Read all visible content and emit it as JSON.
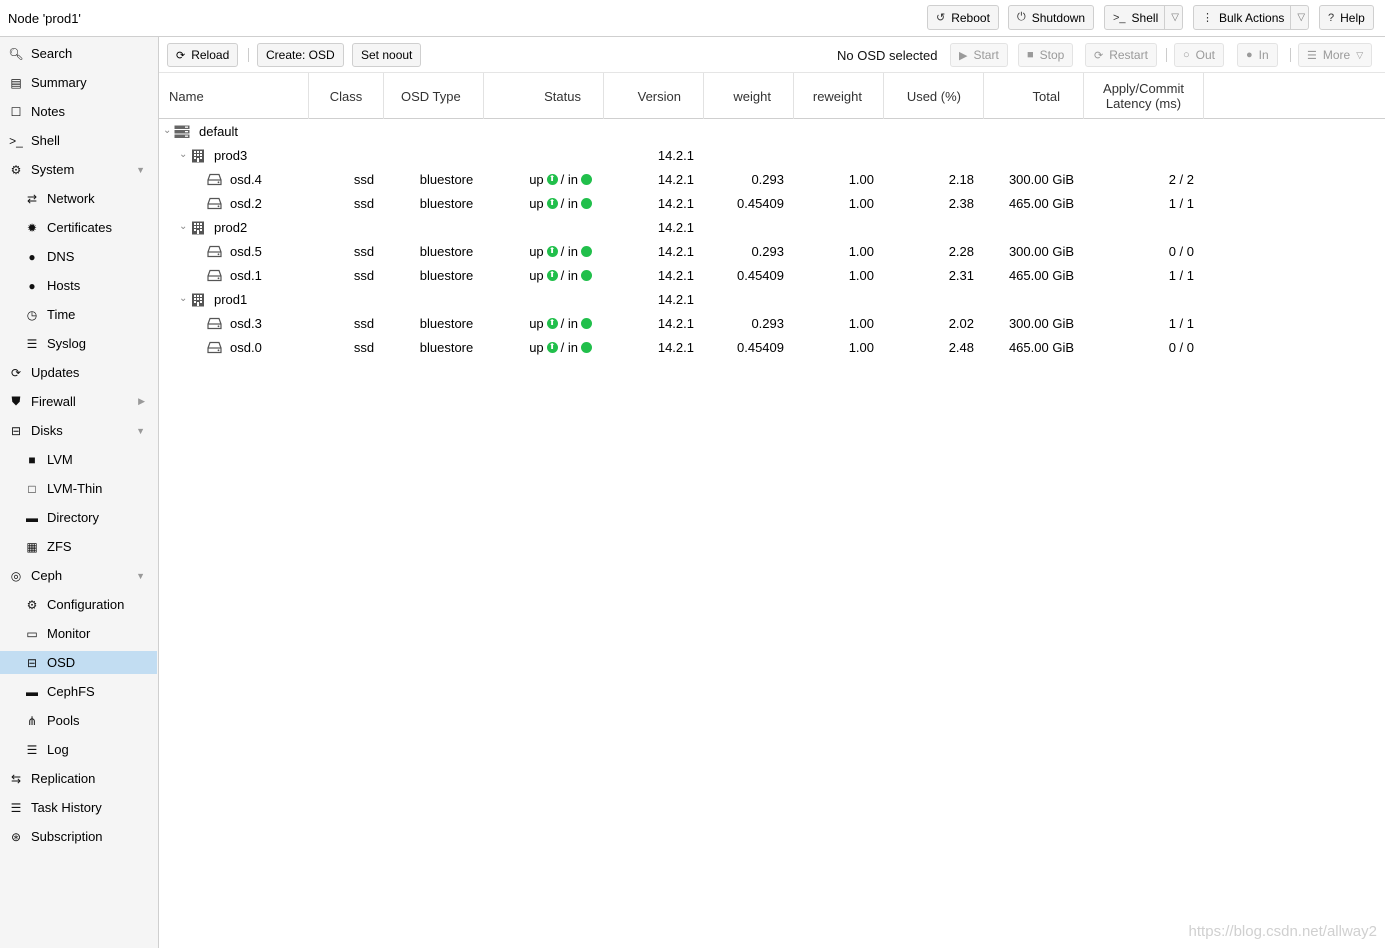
{
  "header": {
    "title": "Node 'prod1'",
    "reboot": "Reboot",
    "shutdown": "Shutdown",
    "shell": "Shell",
    "bulk": "Bulk Actions",
    "help": "Help"
  },
  "sidebar": {
    "items": [
      {
        "label": "Search",
        "icon": "search-icon"
      },
      {
        "label": "Summary",
        "icon": "book-icon"
      },
      {
        "label": "Notes",
        "icon": "note-icon"
      },
      {
        "label": "Shell",
        "icon": "terminal-icon"
      },
      {
        "label": "System",
        "icon": "cogs-icon"
      },
      {
        "label": "Network",
        "icon": "exchange-icon"
      },
      {
        "label": "Certificates",
        "icon": "certificate-icon"
      },
      {
        "label": "DNS",
        "icon": "globe-icon"
      },
      {
        "label": "Hosts",
        "icon": "globe-icon"
      },
      {
        "label": "Time",
        "icon": "clock-icon"
      },
      {
        "label": "Syslog",
        "icon": "list-icon"
      },
      {
        "label": "Updates",
        "icon": "refresh-icon"
      },
      {
        "label": "Firewall",
        "icon": "shield-icon"
      },
      {
        "label": "Disks",
        "icon": "hdd-icon"
      },
      {
        "label": "LVM",
        "icon": "square-icon"
      },
      {
        "label": "LVM-Thin",
        "icon": "square-outline-icon"
      },
      {
        "label": "Directory",
        "icon": "folder-icon"
      },
      {
        "label": "ZFS",
        "icon": "th-large-icon"
      },
      {
        "label": "Ceph",
        "icon": "ceph-icon"
      },
      {
        "label": "Configuration",
        "icon": "gear-icon"
      },
      {
        "label": "Monitor",
        "icon": "desktop-icon"
      },
      {
        "label": "OSD",
        "icon": "hdd-icon"
      },
      {
        "label": "CephFS",
        "icon": "folder-icon"
      },
      {
        "label": "Pools",
        "icon": "sitemap-icon"
      },
      {
        "label": "Log",
        "icon": "list-icon"
      },
      {
        "label": "Replication",
        "icon": "retweet-icon"
      },
      {
        "label": "Task History",
        "icon": "list-icon"
      },
      {
        "label": "Subscription",
        "icon": "support-icon"
      }
    ]
  },
  "toolbar": {
    "reload": "Reload",
    "create": "Create: OSD",
    "noout": "Set noout",
    "status": "No OSD selected",
    "start": "Start",
    "stop": "Stop",
    "restart": "Restart",
    "out": "Out",
    "in": "In",
    "more": "More"
  },
  "columns": {
    "name": "Name",
    "class": "Class",
    "osdtype": "OSD Type",
    "status": "Status",
    "version": "Version",
    "weight": "weight",
    "reweight": "reweight",
    "used": "Used (%)",
    "total": "Total",
    "latency1": "Apply/Commit",
    "latency2": "Latency (ms)"
  },
  "tree": {
    "root": "default",
    "hosts": [
      {
        "name": "prod3",
        "version": "14.2.1",
        "osds": [
          {
            "name": "osd.4",
            "class": "ssd",
            "type": "bluestore",
            "status_up": "up",
            "status_in": "/ in",
            "version": "14.2.1",
            "weight": "0.293",
            "reweight": "1.00",
            "used": "2.18",
            "total": "300.00 GiB",
            "latency": "2 / 2"
          },
          {
            "name": "osd.2",
            "class": "ssd",
            "type": "bluestore",
            "status_up": "up",
            "status_in": "/ in",
            "version": "14.2.1",
            "weight": "0.45409",
            "reweight": "1.00",
            "used": "2.38",
            "total": "465.00 GiB",
            "latency": "1 / 1"
          }
        ]
      },
      {
        "name": "prod2",
        "version": "14.2.1",
        "osds": [
          {
            "name": "osd.5",
            "class": "ssd",
            "type": "bluestore",
            "status_up": "up",
            "status_in": "/ in",
            "version": "14.2.1",
            "weight": "0.293",
            "reweight": "1.00",
            "used": "2.28",
            "total": "300.00 GiB",
            "latency": "0 / 0"
          },
          {
            "name": "osd.1",
            "class": "ssd",
            "type": "bluestore",
            "status_up": "up",
            "status_in": "/ in",
            "version": "14.2.1",
            "weight": "0.45409",
            "reweight": "1.00",
            "used": "2.31",
            "total": "465.00 GiB",
            "latency": "1 / 1"
          }
        ]
      },
      {
        "name": "prod1",
        "version": "14.2.1",
        "osds": [
          {
            "name": "osd.3",
            "class": "ssd",
            "type": "bluestore",
            "status_up": "up",
            "status_in": "/ in",
            "version": "14.2.1",
            "weight": "0.293",
            "reweight": "1.00",
            "used": "2.02",
            "total": "300.00 GiB",
            "latency": "1 / 1"
          },
          {
            "name": "osd.0",
            "class": "ssd",
            "type": "bluestore",
            "status_up": "up",
            "status_in": "/ in",
            "version": "14.2.1",
            "weight": "0.45409",
            "reweight": "1.00",
            "used": "2.48",
            "total": "465.00 GiB",
            "latency": "0 / 0"
          }
        ]
      }
    ]
  },
  "watermark": "https://blog.csdn.net/allway2",
  "colors": {
    "selected": "#c2ddf2",
    "status_green": "#21bf4b",
    "sidebar_bg": "#f5f5f5"
  }
}
